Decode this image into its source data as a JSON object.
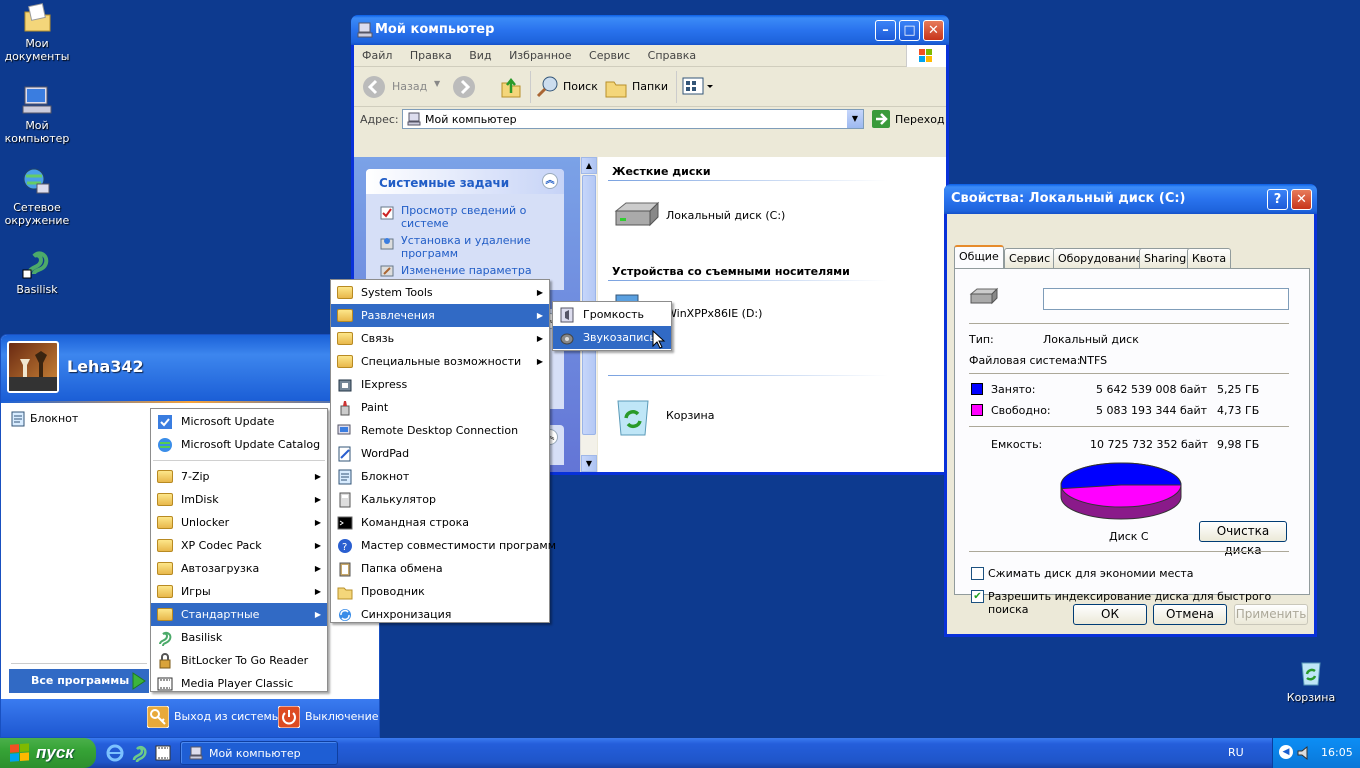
{
  "desktop": {
    "icons": [
      {
        "label": "Мои документы"
      },
      {
        "label": "Мой компьютер"
      },
      {
        "label": "Сетевое окружение"
      },
      {
        "label": "Basilisk"
      },
      {
        "label": "Корзина"
      }
    ]
  },
  "explorer": {
    "title": "Мой компьютер",
    "menu": [
      "Файл",
      "Правка",
      "Вид",
      "Избранное",
      "Сервис",
      "Справка"
    ],
    "toolbar": {
      "back": "Назад",
      "search": "Поиск",
      "folders": "Папки"
    },
    "address_label": "Адрес:",
    "address_value": "Мой компьютер",
    "go_label": "Переход",
    "tasks_title": "Системные задачи",
    "tasks": [
      "Просмотр сведений о системе",
      "Установка и удаление программ",
      "Изменение параметра"
    ],
    "groups": {
      "hdd": "Жесткие диски",
      "removable": "Устройства со съемными носителями"
    },
    "items": {
      "local_disk": "Локальный диск (C:)",
      "cd": "WinXPPx86IE (D:)",
      "recycle": "Корзина"
    }
  },
  "startmenu": {
    "user": "Leha342",
    "pinned": [
      "Блокнот"
    ],
    "all_programs": "Все программы",
    "logoff": "Выход из системы",
    "shutdown": "Выключение"
  },
  "programs_menu": {
    "top": [
      "Microsoft Update",
      "Microsoft Update Catalog"
    ],
    "items": [
      {
        "label": "7-Zip",
        "sub": true
      },
      {
        "label": "ImDisk",
        "sub": true
      },
      {
        "label": "Unlocker",
        "sub": true
      },
      {
        "label": "XP Codec Pack",
        "sub": true
      },
      {
        "label": "Автозагрузка",
        "sub": true
      },
      {
        "label": "Игры",
        "sub": true
      },
      {
        "label": "Стандартные",
        "sub": true,
        "selected": true
      },
      {
        "label": "Basilisk",
        "sub": false
      },
      {
        "label": "BitLocker To Go Reader",
        "sub": false
      },
      {
        "label": "Media Player Classic",
        "sub": false
      }
    ]
  },
  "accessories_menu": {
    "items": [
      {
        "label": "System Tools",
        "sub": true
      },
      {
        "label": "Развлечения",
        "sub": true,
        "selected": true
      },
      {
        "label": "Связь",
        "sub": true
      },
      {
        "label": "Специальные возможности",
        "sub": true
      },
      {
        "label": "IExpress",
        "sub": false
      },
      {
        "label": "Paint",
        "sub": false
      },
      {
        "label": "Remote Desktop Connection",
        "sub": false
      },
      {
        "label": "WordPad",
        "sub": false
      },
      {
        "label": "Блокнот",
        "sub": false
      },
      {
        "label": "Калькулятор",
        "sub": false
      },
      {
        "label": "Командная строка",
        "sub": false
      },
      {
        "label": "Мастер совместимости программ",
        "sub": false
      },
      {
        "label": "Папка обмена",
        "sub": false
      },
      {
        "label": "Проводник",
        "sub": false
      },
      {
        "label": "Синхронизация",
        "sub": false
      }
    ]
  },
  "entertainment_menu": {
    "items": [
      {
        "label": "Громкость",
        "selected": false
      },
      {
        "label": "Звукозапись",
        "selected": true
      }
    ]
  },
  "properties": {
    "title": "Свойства: Локальный диск (C:)",
    "tabs": [
      "Общие",
      "Сервис",
      "Оборудование",
      "Sharing",
      "Квота"
    ],
    "active_tab": "Общие",
    "volume_label_value": "",
    "type_label": "Тип:",
    "type_value": "Локальный диск",
    "fs_label": "Файловая система:",
    "fs_value": "NTFS",
    "used_label": "Занято:",
    "used_bytes": "5 642 539 008 байт",
    "used_gb": "5,25 ГБ",
    "free_label": "Свободно:",
    "free_bytes": "5 083 193 344 байт",
    "free_gb": "4,73 ГБ",
    "cap_label": "Емкость:",
    "cap_bytes": "10 725 732 352 байт",
    "cap_gb": "9,98 ГБ",
    "used_fraction": 0.526,
    "used_color": "#0000ff",
    "free_color": "#ff00ff",
    "disk_caption": "Диск C",
    "cleanup": "Очистка диска",
    "compress": "Сжимать диск для экономии места",
    "compress_checked": false,
    "index": "Разрешить индексирование диска для быстрого поиска",
    "index_checked": true,
    "ok": "ОК",
    "cancel": "Отмена",
    "apply": "Применить"
  },
  "taskbar": {
    "start": "пуск",
    "task": "Мой компьютер",
    "lang": "RU",
    "clock": "16:05"
  }
}
